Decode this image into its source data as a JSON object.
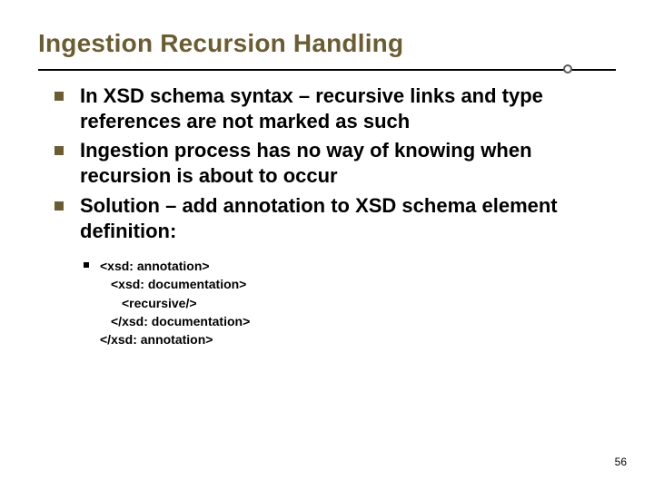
{
  "title": "Ingestion Recursion Handling",
  "bullets": [
    "In XSD schema syntax – recursive links and type references are not marked as such",
    "Ingestion process has no way of knowing when recursion is about to occur",
    "Solution – add annotation to XSD schema element definition:"
  ],
  "code": {
    "l1": "<xsd: annotation>",
    "l2": "<xsd: documentation>",
    "l3": "<recursive/>",
    "l4": "</xsd: documentation>",
    "l5": "</xsd: annotation>"
  },
  "page_number": "56"
}
